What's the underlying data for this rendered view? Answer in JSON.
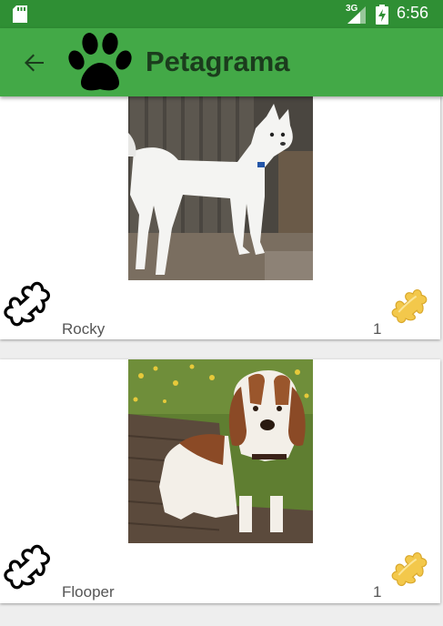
{
  "status_bar": {
    "network": "3G",
    "time": "6:56",
    "icons": [
      "sd-card-icon",
      "signal-icon",
      "battery-charging-icon"
    ]
  },
  "app_bar": {
    "title": "Petagrama",
    "icons": [
      "back-arrow-icon",
      "paw-icon"
    ]
  },
  "pets": [
    {
      "name": "Rocky",
      "likes": "1",
      "photo": "white-husky-dog-photo"
    },
    {
      "name": "Flooper",
      "likes": "1",
      "photo": "basset-hound-dog-photo"
    }
  ],
  "colors": {
    "status_bar": "#2f8f34",
    "app_bar": "#43a947",
    "title_text": "#1b3c1d",
    "bone_gold": "#f3c84b"
  }
}
